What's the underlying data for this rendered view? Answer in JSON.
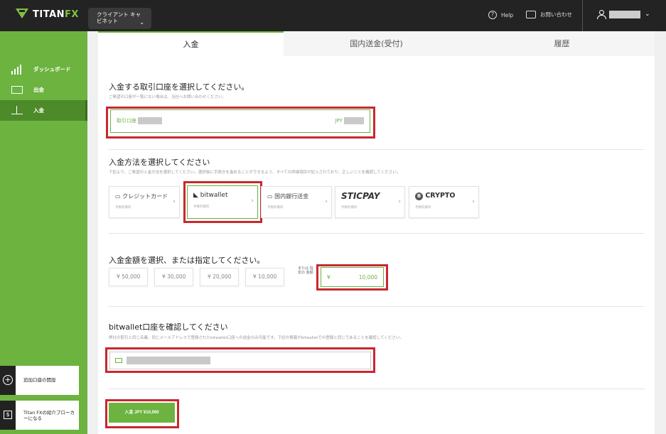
{
  "header": {
    "brand_prefix": "TITAN",
    "brand_suffix": "FX",
    "cabinet_label": "クライアント キャビネット",
    "help_label": "Help",
    "contact_label": "お問い合わせ"
  },
  "sidebar": {
    "items": [
      {
        "label": "ダッシュボード",
        "icon": "bar-chart-icon"
      },
      {
        "label": "出金",
        "icon": "withdraw-icon"
      },
      {
        "label": "入金",
        "icon": "deposit-icon"
      }
    ],
    "open_account_label": "追加口座の開設",
    "introducing_broker_label": "Titan FXの紹介ブローカーになる"
  },
  "tabs": [
    {
      "label": "入金"
    },
    {
      "label": "国内送金(受付)"
    },
    {
      "label": "履歴"
    }
  ],
  "account_section": {
    "title": "入金する取引口座を選択してください。",
    "hint": "ご希望の口座が一覧にない場合は、当社へお問い合わせください。",
    "account_label": "取引口座",
    "currency": "JPY"
  },
  "method_section": {
    "title": "入金方法を選択してください",
    "hint": "下記より、ご希望の入金方法を選択してください。選択後に手続きを進めることができるよう、すべての詳細項目が記入されており、正しいことを確認してください。",
    "methods": [
      {
        "name": "クレジットカード",
        "sub": "手数料無料",
        "icon": "credit-card-icon"
      },
      {
        "name": "bitwallet",
        "sub": "手数料無料",
        "icon": "bitwallet-icon"
      },
      {
        "name": "国内銀行送金",
        "sub": "手数料無料",
        "icon": "bank-transfer-icon"
      },
      {
        "name": "STICPAY",
        "sub": "手数料無料",
        "icon": ""
      },
      {
        "name": "CRYPTO",
        "sub": "手数料無料",
        "icon": "bitcoin-icon"
      }
    ],
    "selected": "bitwallet"
  },
  "amount_section": {
    "title": "入金金額を選択、または指定してください。",
    "presets": [
      "¥ 50,000",
      "¥ 30,000",
      "¥ 20,000",
      "¥ 10,000"
    ],
    "custom_label": "または 指定の 金額",
    "custom_currency": "¥",
    "custom_value": "10,000"
  },
  "wallet_section": {
    "title": "bitwallet口座を確認してください",
    "hint": "弊社の取引と同じ名義、同じメールアドレスで登録されたbitwallet口座への送金のみ可能です。下記の情報がbitwalletでの登録と同じであることを確認してください。"
  },
  "submit": {
    "label": "入金 JPY ¥10,000"
  },
  "colors": {
    "brand_green": "#6cb33f",
    "highlight_red": "#c8282e",
    "topbar": "#232323"
  }
}
